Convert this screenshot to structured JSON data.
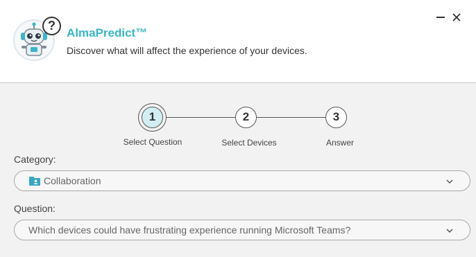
{
  "header": {
    "title": "AlmaPredict™",
    "subtitle": "Discover what will affect the experience of your devices.",
    "help_badge": "?"
  },
  "window_controls": {
    "minimize_icon": "minimize-icon",
    "close_icon": "close-icon"
  },
  "stepper": {
    "steps": [
      {
        "number": "1",
        "label": "Select Question",
        "state": "active"
      },
      {
        "number": "2",
        "label": "Select Devices",
        "state": "inactive"
      },
      {
        "number": "3",
        "label": "Answer",
        "state": "inactive"
      }
    ],
    "active_color": "#d2eef3"
  },
  "form": {
    "category": {
      "label": "Category:",
      "value": "Collaboration",
      "icon": "folder-user-icon"
    },
    "question": {
      "label": "Question:",
      "value": "Which devices could have frustrating experience running Microsoft Teams?"
    }
  },
  "colors": {
    "brand": "#38b6c8",
    "background": "#f2f2f2",
    "header_bg": "#ffffff"
  }
}
